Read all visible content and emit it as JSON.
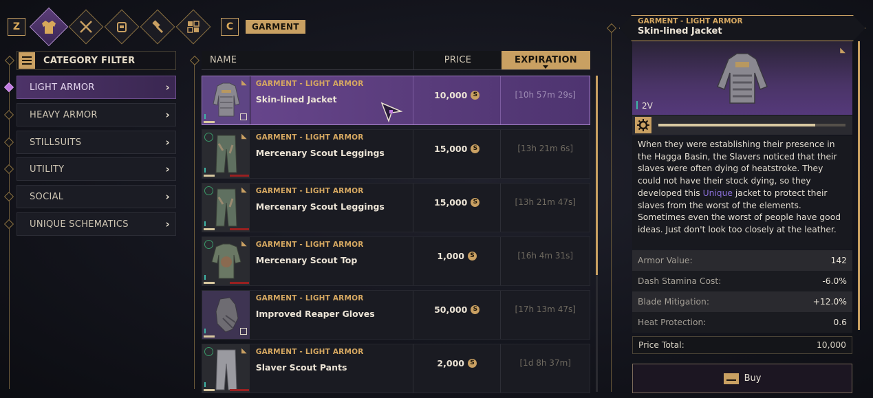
{
  "tabs": {
    "left_key": "Z",
    "right_key": "C",
    "icons": [
      "armor-icon",
      "crossed-swords-icon",
      "backpack-icon",
      "hammer-icon",
      "modules-icon"
    ],
    "active_index": 0,
    "active_label": "GARMENT"
  },
  "filter": {
    "title": "CATEGORY FILTER",
    "items": [
      {
        "label": "LIGHT ARMOR",
        "active": true
      },
      {
        "label": "HEAVY ARMOR",
        "active": false
      },
      {
        "label": "STILLSUITS",
        "active": false
      },
      {
        "label": "UTILITY",
        "active": false
      },
      {
        "label": "SOCIAL",
        "active": false
      },
      {
        "label": "UNIQUE SCHEMATICS",
        "active": false
      }
    ]
  },
  "table": {
    "columns": {
      "name": "NAME",
      "price": "PRICE",
      "expiration": "EXPIRATION"
    },
    "currency_symbol": "S",
    "rows": [
      {
        "category": "GARMENT - LIGHT ARMOR",
        "name": "Skin-lined Jacket",
        "price": "10,000",
        "expiration": "[10h 57m 29s]",
        "selected": true
      },
      {
        "category": "GARMENT - LIGHT ARMOR",
        "name": "Mercenary Scout Leggings",
        "price": "15,000",
        "expiration": "[13h 21m 6s]",
        "selected": false
      },
      {
        "category": "GARMENT - LIGHT ARMOR",
        "name": "Mercenary Scout Leggings",
        "price": "15,000",
        "expiration": "[13h 21m 47s]",
        "selected": false
      },
      {
        "category": "GARMENT - LIGHT ARMOR",
        "name": "Mercenary Scout Top",
        "price": "1,000",
        "expiration": "[16h 4m 31s]",
        "selected": false
      },
      {
        "category": "GARMENT - LIGHT ARMOR",
        "name": "Improved Reaper Gloves",
        "price": "50,000",
        "expiration": "[17h 13m 47s]",
        "selected": false
      },
      {
        "category": "GARMENT - LIGHT ARMOR",
        "name": "Slaver Scout Pants",
        "price": "2,000",
        "expiration": "[1d 8h 37m]",
        "selected": false
      }
    ]
  },
  "detail": {
    "category": "GARMENT - LIGHT ARMOR",
    "name": "Skin-lined Jacket",
    "tier": "2V",
    "durability_fraction": 0.84,
    "description_before": "When they were establishing their presence in the Hagga Basin, the Slavers noticed that their slaves were often dying of heatstroke. They could not have their stock dying, so they developed this ",
    "description_highlight": "Unique",
    "description_after": " jacket to protect their slaves from the worst of the elements. Sometimes even the worst of people have good ideas. Just don't look too closely at the leather.",
    "stats": [
      {
        "label": "Armor Value:",
        "value": "142"
      },
      {
        "label": "Dash Stamina Cost:",
        "value": "-6.0%"
      },
      {
        "label": "Blade Mitigation:",
        "value": "+12.0%"
      },
      {
        "label": "Heat Protection:",
        "value": "0.6"
      }
    ],
    "price_total_label": "Price Total:",
    "price_total_value": "10,000",
    "buy_label": "Buy"
  },
  "colors": {
    "accent_gold": "#c9a062",
    "selected_purple": "#5b3d7d",
    "unique_text": "#8a6fd8"
  }
}
